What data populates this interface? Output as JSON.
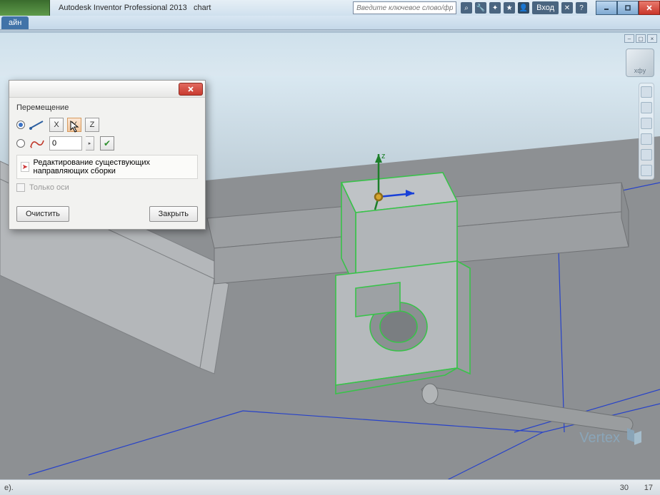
{
  "title": {
    "app": "Autodesk Inventor Professional 2013",
    "doc": "chart"
  },
  "search": {
    "placeholder": "Введите ключевое слово/фразу"
  },
  "login_label": "Вход",
  "ribbon": {
    "active_tab": "айн"
  },
  "viewcube": {
    "face": "xфy"
  },
  "dialog": {
    "title": "Перемещение",
    "axis": {
      "x": "X",
      "y": "Y",
      "z": "Z"
    },
    "value": "0",
    "edit_label": "Редактирование существующих направляющих сборки",
    "axes_only": "Только оси",
    "clear": "Очистить",
    "close": "Закрыть"
  },
  "watermark": "Vertex",
  "status": {
    "left": "e).",
    "a": "30",
    "b": "17"
  }
}
